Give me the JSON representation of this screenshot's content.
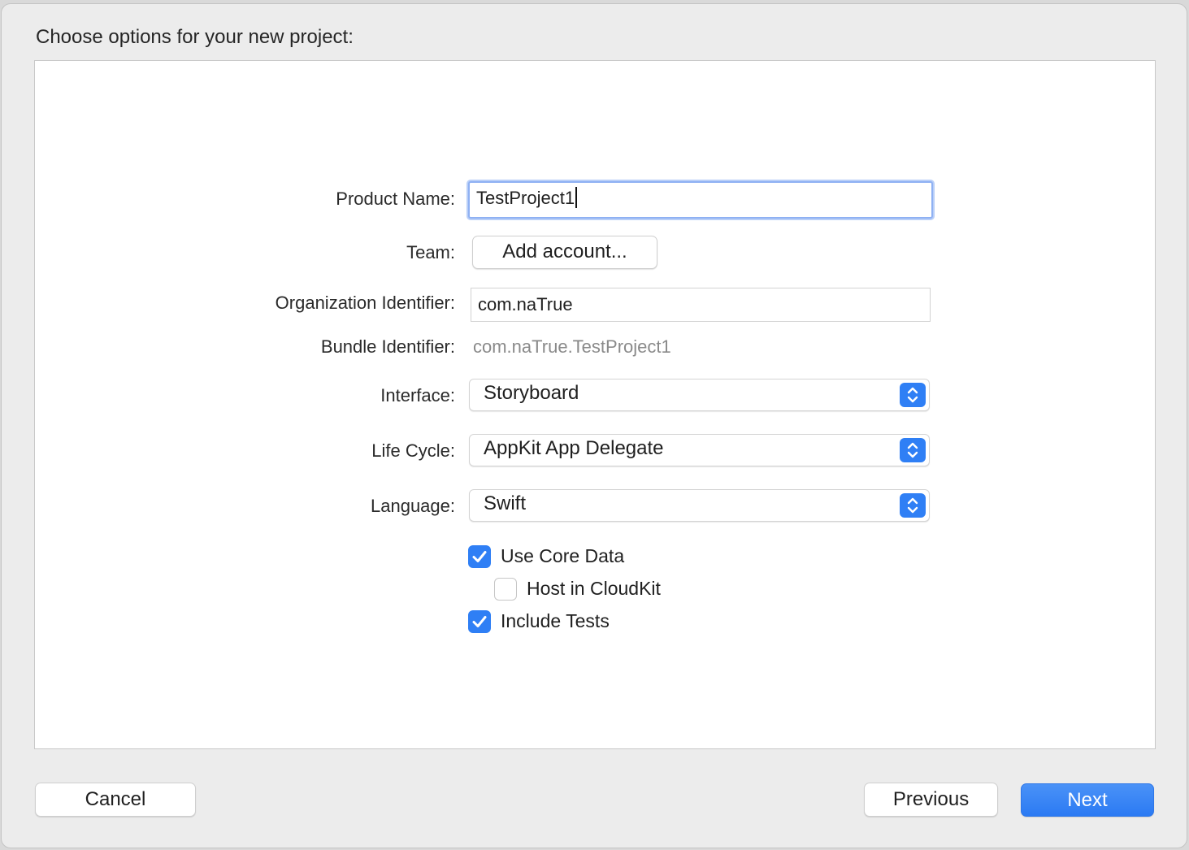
{
  "dialog": {
    "title": "Choose options for your new project:"
  },
  "form": {
    "product_name": {
      "label": "Product Name:",
      "value": "TestProject1"
    },
    "team": {
      "label": "Team:",
      "button_label": "Add account..."
    },
    "organization_identifier": {
      "label": "Organization Identifier:",
      "value": "com.naTrue"
    },
    "bundle_identifier": {
      "label": "Bundle Identifier:",
      "value": "com.naTrue.TestProject1"
    },
    "interface": {
      "label": "Interface:",
      "selected": "Storyboard"
    },
    "life_cycle": {
      "label": "Life Cycle:",
      "selected": "AppKit App Delegate"
    },
    "language": {
      "label": "Language:",
      "selected": "Swift"
    },
    "options": [
      {
        "label": "Use Core Data",
        "checked": true
      },
      {
        "label": "Host in CloudKit",
        "checked": false
      },
      {
        "label": "Include Tests",
        "checked": true
      }
    ]
  },
  "footer": {
    "cancel_label": "Cancel",
    "previous_label": "Previous",
    "next_label": "Next"
  },
  "colors": {
    "accent": "#2f7ff5",
    "focus_ring": "#8fb1f3",
    "background": "#ececec"
  }
}
